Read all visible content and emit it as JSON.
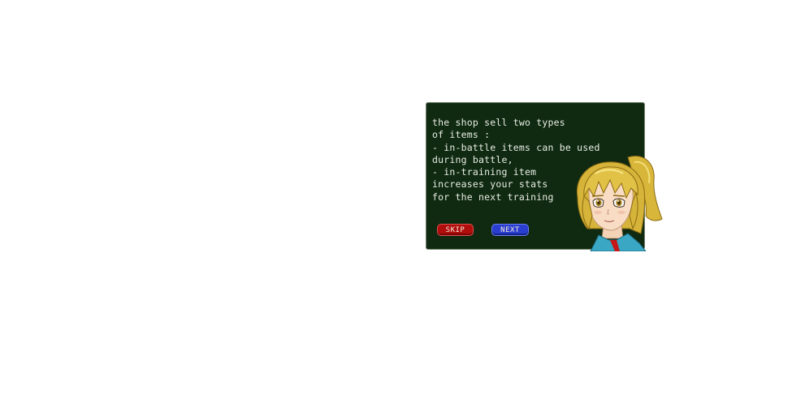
{
  "dialog": {
    "lines": [
      "the shop sell two types",
      "of items :",
      "- in-battle items can be used",
      "during battle,",
      "- in-training item",
      "increases your stats",
      "for the next training"
    ],
    "skip_label": "SKIP",
    "next_label": "NEXT"
  },
  "portrait": {
    "icon": "blonde-girl-portrait"
  },
  "colors": {
    "dialog_bg": "#0f2a10",
    "skip": "#b00d0d",
    "next": "#2a3fd0",
    "text": "#e9ece4"
  }
}
